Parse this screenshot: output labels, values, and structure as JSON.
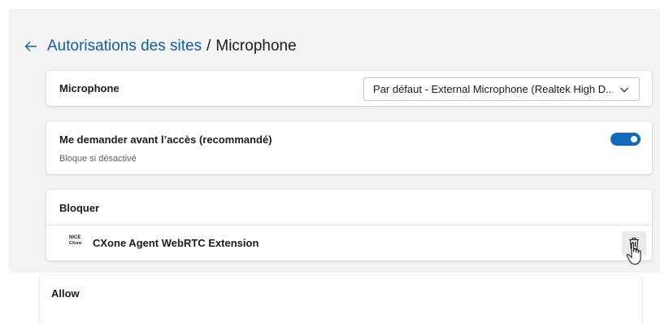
{
  "breadcrumb": {
    "back_icon": "back-arrow-icon",
    "parent": "Autorisations des sites",
    "separator": "/",
    "current": "Microphone"
  },
  "microphone_card": {
    "label": "Microphone",
    "select_value": "Par défaut - External Microphone (Realtek High D...",
    "chevron_icon": "chevron-down-icon"
  },
  "ask_card": {
    "label": "Me demander avant l’accès (recommandé)",
    "sublabel": "Bloque si désactivé",
    "toggle_on": true
  },
  "block_card": {
    "header": "Bloquer",
    "sites": [
      {
        "icon_text_top": "NICE",
        "icon_text_bottom": "CXone",
        "name": "CXone Agent WebRTC Extension",
        "delete_icon": "trash-icon"
      }
    ]
  },
  "allow_card": {
    "header": "Allow"
  },
  "colors": {
    "accent": "#0f6cbd",
    "link": "#115ea3",
    "page_background": "#f3f3f3",
    "card_background": "#ffffff"
  }
}
